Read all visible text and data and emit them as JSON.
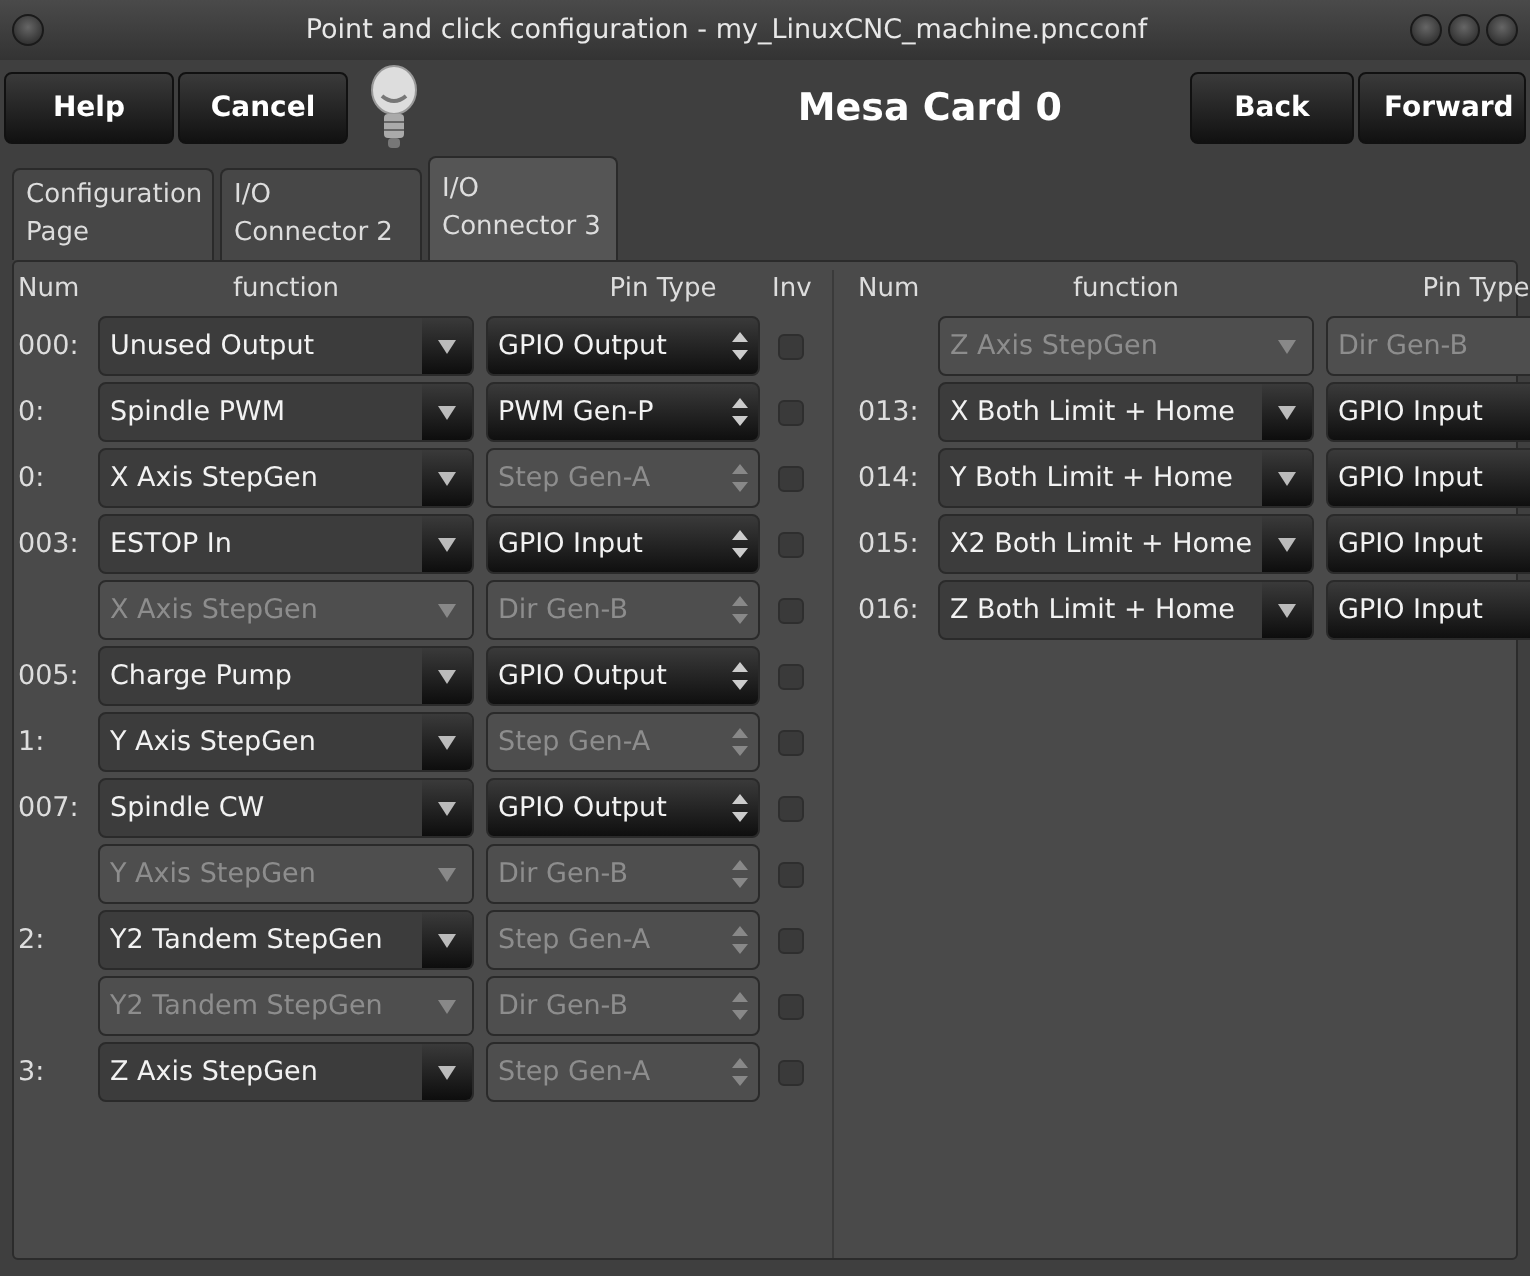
{
  "window": {
    "title": "Point and click configuration - my_LinuxCNC_machine.pncconf"
  },
  "toolbar": {
    "left_buttons": [
      "Help",
      "Cancel"
    ],
    "heading": "Mesa Card 0",
    "right_buttons": [
      "Back",
      "Forward"
    ]
  },
  "tabs": [
    {
      "label": "Configuration Page",
      "selected": false
    },
    {
      "label": "I/O Connector 2",
      "selected": false
    },
    {
      "label": "I/O Connector 3",
      "selected": true
    }
  ],
  "left_table": {
    "columns": [
      "Num",
      "function",
      "Pin Type",
      "Inv"
    ],
    "rows": [
      {
        "num": "000:",
        "function": "Unused Output",
        "function_enabled": true,
        "pin_type": "GPIO Output",
        "pin_type_enabled": true,
        "inv": false
      },
      {
        "num": "0:",
        "function": "Spindle PWM",
        "function_enabled": true,
        "pin_type": "PWM Gen-P",
        "pin_type_enabled": true,
        "inv": false
      },
      {
        "num": "0:",
        "function": "X Axis StepGen",
        "function_enabled": true,
        "pin_type": "Step Gen-A",
        "pin_type_enabled": false,
        "inv": false
      },
      {
        "num": "003:",
        "function": "ESTOP In",
        "function_enabled": true,
        "pin_type": "GPIO Input",
        "pin_type_enabled": true,
        "inv": false
      },
      {
        "function": "X Axis StepGen",
        "function_enabled": false,
        "pin_type": "Dir Gen-B",
        "pin_type_enabled": false,
        "inv": false
      },
      {
        "num": "005:",
        "function": "Charge Pump",
        "function_enabled": true,
        "pin_type": "GPIO Output",
        "pin_type_enabled": true,
        "inv": false
      },
      {
        "num": "1:",
        "function": "Y Axis StepGen",
        "function_enabled": true,
        "pin_type": "Step Gen-A",
        "pin_type_enabled": false,
        "inv": false
      },
      {
        "num": "007:",
        "function": "Spindle CW",
        "function_enabled": true,
        "pin_type": "GPIO Output",
        "pin_type_enabled": true,
        "inv": false
      },
      {
        "function": "Y Axis StepGen",
        "function_enabled": false,
        "pin_type": "Dir Gen-B",
        "pin_type_enabled": false,
        "inv": false
      },
      {
        "num": "2:",
        "function": "Y2 Tandem StepGen",
        "function_enabled": true,
        "pin_type": "Step Gen-A",
        "pin_type_enabled": false,
        "inv": false
      },
      {
        "function": "Y2 Tandem StepGen",
        "function_enabled": false,
        "pin_type": "Dir Gen-B",
        "pin_type_enabled": false,
        "inv": false
      },
      {
        "num": "3:",
        "function": "Z Axis StepGen",
        "function_enabled": true,
        "pin_type": "Step Gen-A",
        "pin_type_enabled": false,
        "inv": false
      }
    ]
  },
  "right_table": {
    "columns": [
      "Num",
      "function",
      "Pin Type"
    ],
    "rows": [
      {
        "function": "Z Axis StepGen",
        "function_enabled": false,
        "pin_type": "Dir Gen-B",
        "pin_type_enabled": false
      },
      {
        "num": "013:",
        "function": "X Both Limit + Home",
        "function_enabled": true,
        "pin_type": "GPIO Input",
        "pin_type_enabled": true
      },
      {
        "num": "014:",
        "function": "Y Both Limit + Home",
        "function_enabled": true,
        "pin_type": "GPIO Input",
        "pin_type_enabled": true
      },
      {
        "num": "015:",
        "function": "X2 Both Limit + Home",
        "function_enabled": true,
        "pin_type": "GPIO Input",
        "pin_type_enabled": true
      },
      {
        "num": "016:",
        "function": "Z Both Limit + Home",
        "function_enabled": true,
        "pin_type": "GPIO Input",
        "pin_type_enabled": true
      }
    ]
  }
}
